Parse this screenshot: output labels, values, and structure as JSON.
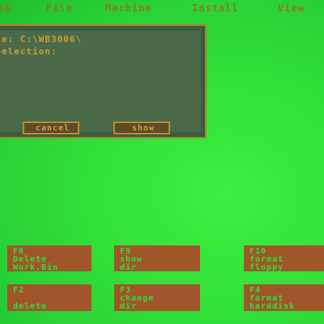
{
  "menubar": {
    "items": [
      {
        "label": "sk"
      },
      {
        "label": "File"
      },
      {
        "label": "Machine"
      },
      {
        "label": "Install"
      },
      {
        "label": "View"
      }
    ]
  },
  "dialog": {
    "path_line": "e:  C:\\WB3006\\",
    "selection_line": "election:",
    "cancel_label": "cancel",
    "show_label": "show"
  },
  "fkeys": {
    "f8": {
      "key": "F8",
      "line1": "Delete",
      "line2": "Work.Bin"
    },
    "f9": {
      "key": "F9",
      "line1": "show",
      "line2": "dir"
    },
    "f10": {
      "key": "F10",
      "line1": "format",
      "line2": "floppy"
    },
    "f2": {
      "key": "F2",
      "line1": "",
      "line2": "delete"
    },
    "f3": {
      "key": "F3",
      "line1": "change",
      "line2": "dir"
    },
    "f4": {
      "key": "F4",
      "line1": "format",
      "line2": "harddisk"
    }
  },
  "colors": {
    "background": "#2ed93a",
    "dialog": "#4b6a4a",
    "fkey_box": "#a0562a",
    "text_gold": "#c9a030"
  }
}
